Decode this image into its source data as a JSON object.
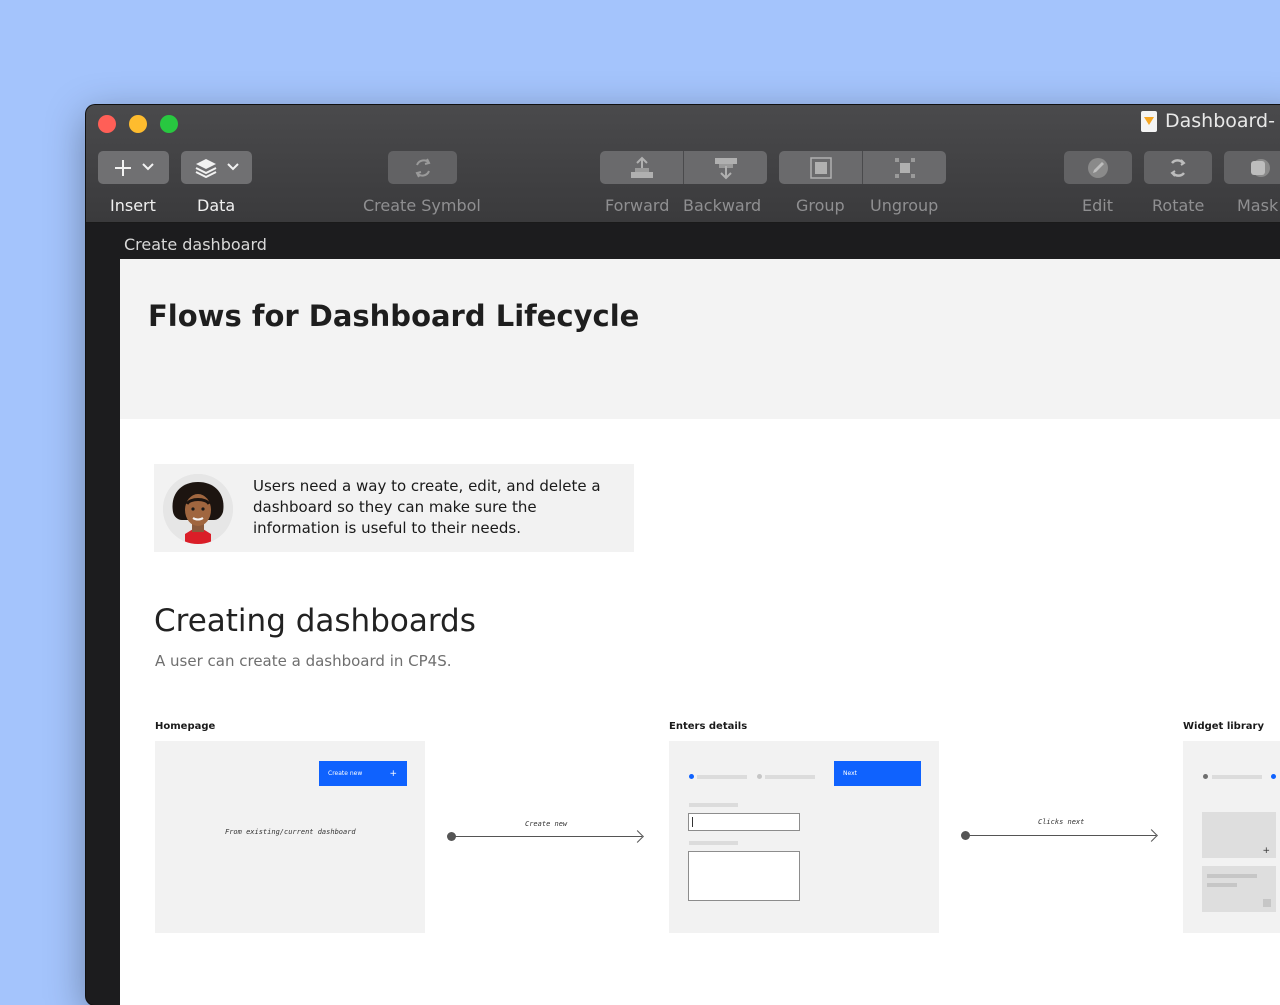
{
  "window": {
    "document_title": "Dashboard-",
    "artboard_label": "Create dashboard"
  },
  "toolbar": {
    "insert": "Insert",
    "data": "Data",
    "create_symbol": "Create Symbol",
    "forward": "Forward",
    "backward": "Backward",
    "group": "Group",
    "ungroup": "Ungroup",
    "edit": "Edit",
    "rotate": "Rotate",
    "mask": "Mask"
  },
  "page": {
    "title": "Flows for Dashboard Lifecycle",
    "persona_text": "Users need a way to create, edit, and delete a dashboard so they can make sure the information is useful to their needs.",
    "section_title": "Creating dashboards",
    "section_subtitle": "A user can create a dashboard in CP4S."
  },
  "flow": {
    "homepage_label": "Homepage",
    "create_new_button": "Create new",
    "homepage_note": "From existing/current dashboard",
    "arrow1_label": "Create new",
    "enters_details_label": "Enters details",
    "next_button": "Next",
    "arrow2_label": "Clicks next",
    "widget_library_label": "Widget library"
  },
  "colors": {
    "background": "#a4c4fc",
    "accent_blue": "#0f62fe"
  }
}
